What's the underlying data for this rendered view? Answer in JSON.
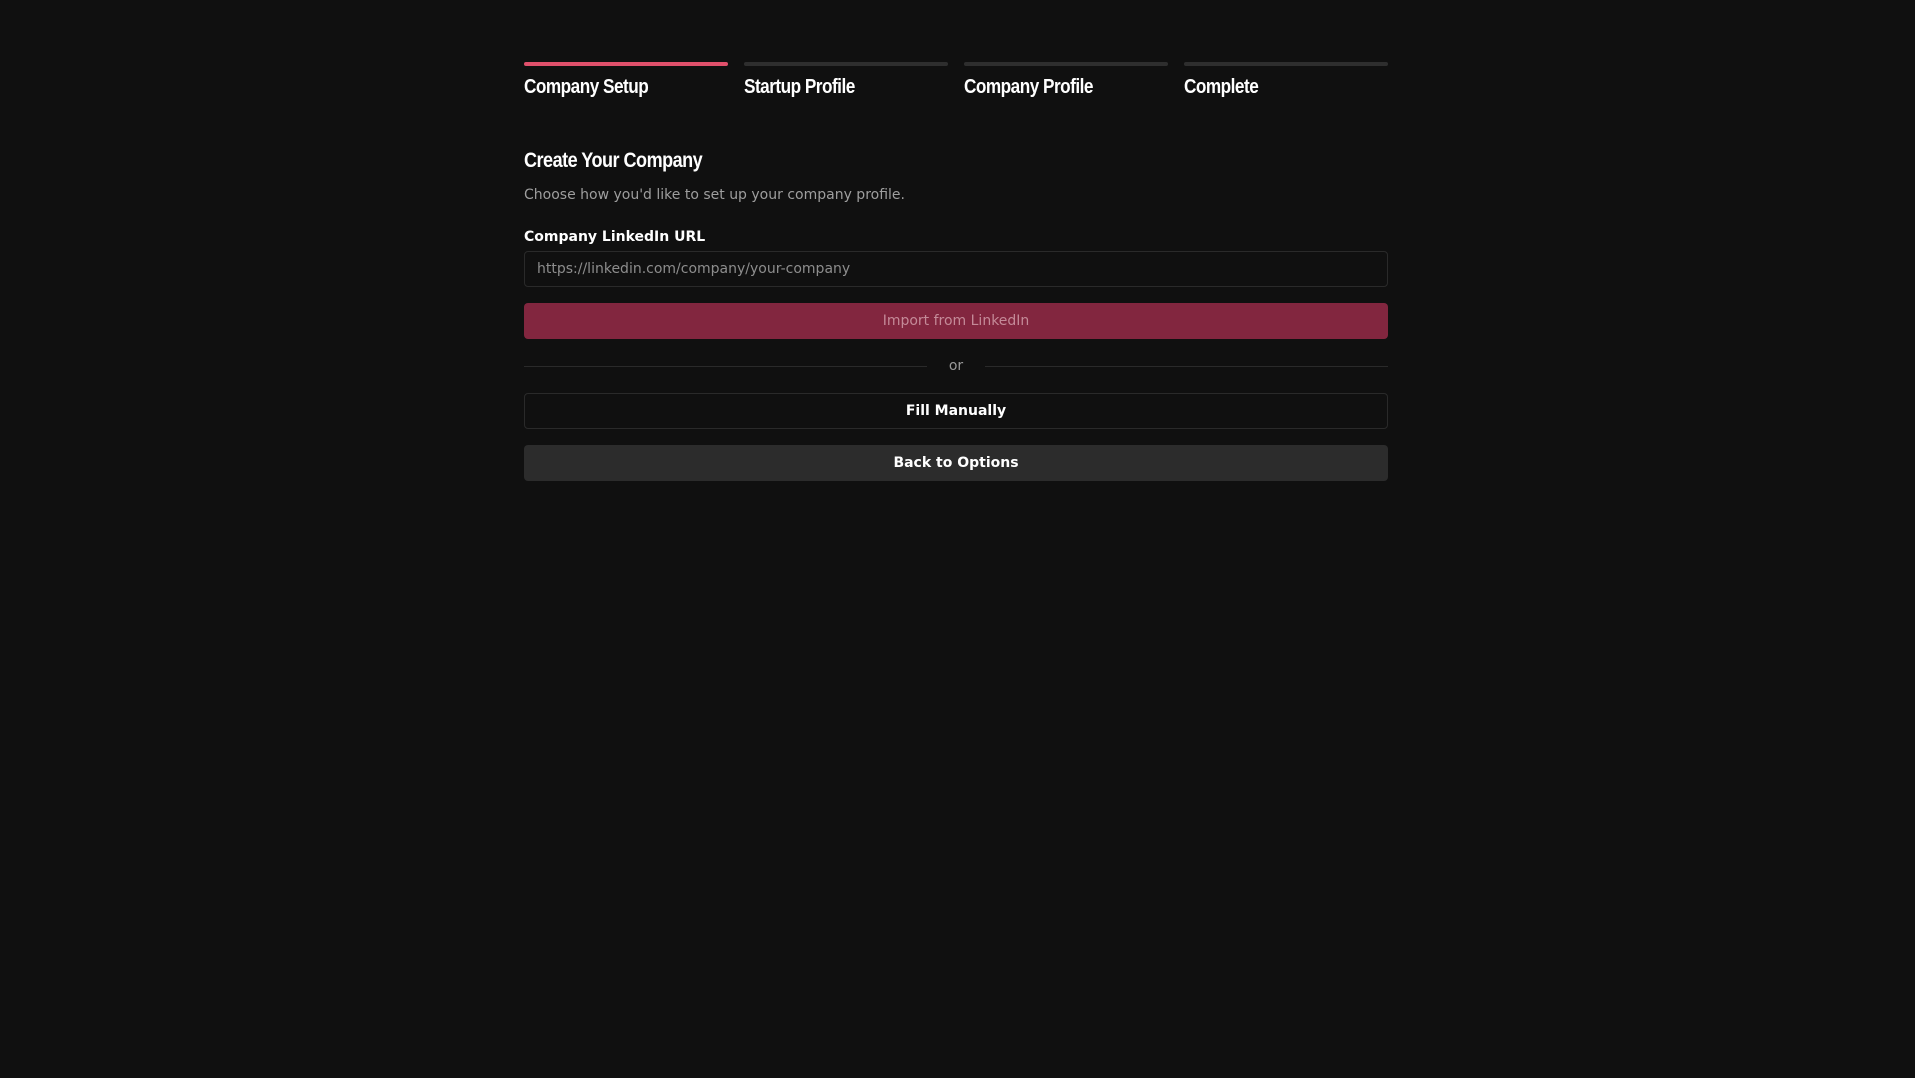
{
  "colors": {
    "background": "#101010",
    "accent": "#e0506b",
    "import_button_bg": "#82263f",
    "inactive_step": "#2e2e2e",
    "secondary_button_bg": "#2c2c2c"
  },
  "stepper": {
    "steps": [
      {
        "label": "Company Setup",
        "active": true
      },
      {
        "label": "Startup Profile",
        "active": false
      },
      {
        "label": "Company Profile",
        "active": false
      },
      {
        "label": "Complete",
        "active": false
      }
    ]
  },
  "form": {
    "title": "Create Your Company",
    "subtitle": "Choose how you'd like to set up your company profile.",
    "linkedin_label": "Company LinkedIn URL",
    "linkedin_value": "",
    "linkedin_placeholder": "https://linkedin.com/company/your-company",
    "import_button": "Import from LinkedIn",
    "divider_text": "or",
    "manual_button": "Fill Manually",
    "back_button": "Back to Options"
  }
}
